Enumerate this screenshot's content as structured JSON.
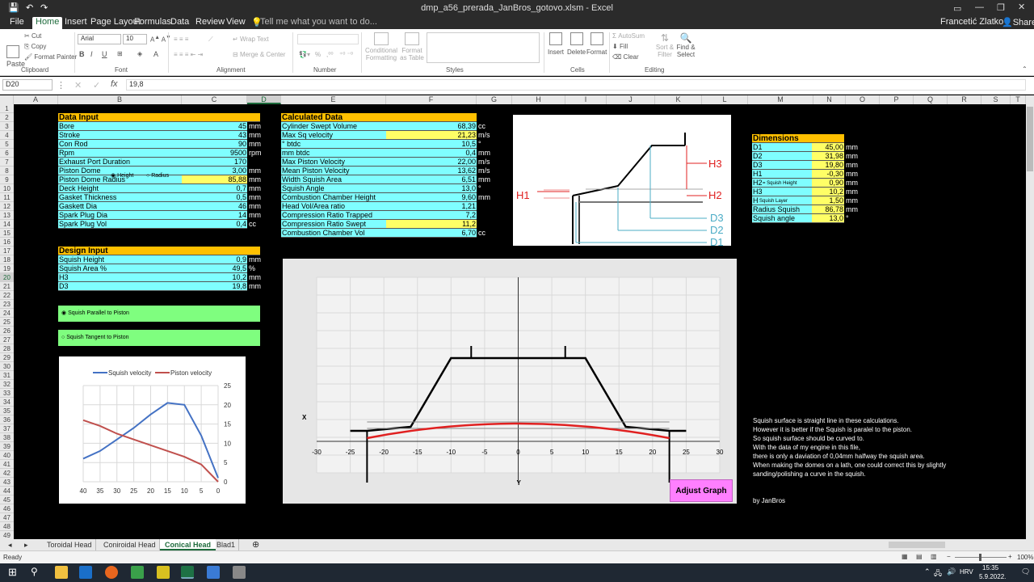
{
  "window": {
    "title": "dmp_a56_prerada_JanBros_gotovo.xlsm - Excel",
    "user": "Francetić Zlatko",
    "share": "Share"
  },
  "tabs": [
    "File",
    "Home",
    "Insert",
    "Page Layout",
    "Formulas",
    "Data",
    "Review",
    "View"
  ],
  "tell_me": "Tell me what you want to do...",
  "ribbon": {
    "clipboard": {
      "paste": "Paste",
      "cut": "Cut",
      "copy": "Copy",
      "format_painter": "Format Painter",
      "label": "Clipboard"
    },
    "font": {
      "name": "Arial",
      "size": "10",
      "label": "Font"
    },
    "alignment": {
      "wrap": "Wrap Text",
      "merge": "Merge & Center",
      "label": "Alignment"
    },
    "number": {
      "label": "Number",
      "percent": "%"
    },
    "styles": {
      "cond": "Conditional Formatting",
      "table": "Format as Table",
      "label": "Styles"
    },
    "cells": {
      "insert": "Insert",
      "delete": "Delete",
      "format": "Format",
      "label": "Cells"
    },
    "editing": {
      "autosum": "AutoSum",
      "fill": "Fill",
      "clear": "Clear",
      "sort": "Sort & Filter",
      "find": "Find & Select",
      "label": "Editing"
    }
  },
  "formula_bar": {
    "name_box": "D20",
    "value": "19,8"
  },
  "columns": [
    "A",
    "B",
    "C",
    "D",
    "E",
    "F",
    "G",
    "H",
    "I",
    "J",
    "K",
    "L",
    "M",
    "N",
    "O",
    "P",
    "Q",
    "R",
    "S",
    "T"
  ],
  "data_input": {
    "title": "Data Input",
    "rows": [
      {
        "label": "Bore",
        "value": "45",
        "unit": "mm"
      },
      {
        "label": "Stroke",
        "value": "43",
        "unit": "mm"
      },
      {
        "label": "Con Rod",
        "value": "90",
        "unit": "mm"
      },
      {
        "label": "Rpm",
        "value": "9500",
        "unit": "rpm"
      },
      {
        "label": "Exhaust Port Duration",
        "value": "170",
        "unit": ""
      },
      {
        "label": "Piston Dome",
        "value": "3,00",
        "unit": "mm"
      },
      {
        "label": "Piston Dome Radius",
        "value": "85,88",
        "unit": "mm"
      },
      {
        "label": "Deck Height",
        "value": "0,7",
        "unit": "mm"
      },
      {
        "label": "Gasket Thickness",
        "value": "0,5",
        "unit": "mm"
      },
      {
        "label": "Gaskett Dia",
        "value": "46",
        "unit": "mm"
      },
      {
        "label": "Spark Plug Dia",
        "value": "14",
        "unit": "mm"
      },
      {
        "label": "Spark Plug Vol",
        "value": "0,4",
        "unit": "cc"
      }
    ],
    "radio_height": "Height",
    "radio_radius": "Radius"
  },
  "design_input": {
    "title": "Design Input",
    "rows": [
      {
        "label": "Squish Height",
        "value": "0,9",
        "unit": "mm"
      },
      {
        "label": "Squish Area   %",
        "value": "49,5",
        "unit": "%"
      },
      {
        "label": "H3",
        "value": "10,2",
        "unit": "mm"
      },
      {
        "label": "D3",
        "value": "19,8",
        "unit": "mm"
      }
    ]
  },
  "options": {
    "parallel": "Squish Parallel to Piston",
    "tangent": "Squish Tangent to Piston"
  },
  "calculated": {
    "title": "Calculated Data",
    "rows": [
      {
        "label": "Cylinder Swept Volume",
        "value": "68,39",
        "unit": "cc"
      },
      {
        "label": "Max Sq velocity",
        "value": "21,23",
        "unit": "m/s"
      },
      {
        "label": "° btdc",
        "value": "10,5",
        "unit": "°"
      },
      {
        "label": "mm btdc",
        "value": "0,4",
        "unit": "mm"
      },
      {
        "label": "Max Piston Velocity",
        "value": "22,00",
        "unit": "m/s"
      },
      {
        "label": "Mean Piston Velocity",
        "value": "13,62",
        "unit": "m/s"
      },
      {
        "label": "Width Squish Area",
        "value": "6,51",
        "unit": "mm"
      },
      {
        "label": "Squish Angle",
        "value": "13,0",
        "unit": "°"
      },
      {
        "label": "Combustion Chamber Height",
        "value": "9,60",
        "unit": "mm"
      },
      {
        "label": "Head Vol/Area ratio",
        "value": "1,21",
        "unit": ""
      },
      {
        "label": "Compression Ratio Trapped",
        "value": "7,2",
        "unit": ""
      },
      {
        "label": "Compression Ratio Swept",
        "value": "11,2",
        "unit": ""
      },
      {
        "label": "Combustion Chamber Vol",
        "value": "6,70",
        "unit": "cc"
      }
    ]
  },
  "dimensions": {
    "title": "Dimensions",
    "rows": [
      {
        "label": "D1",
        "note": "",
        "value": "45,00",
        "unit": "mm"
      },
      {
        "label": "D2",
        "note": "",
        "value": "31,98",
        "unit": "mm"
      },
      {
        "label": "D3",
        "note": "",
        "value": "19,80",
        "unit": "mm"
      },
      {
        "label": "H1",
        "note": "",
        "value": "-0,30",
        "unit": "mm"
      },
      {
        "label": "H2",
        "note": "= Squish Height",
        "value": "0,90",
        "unit": "mm"
      },
      {
        "label": "H3",
        "note": "",
        "value": "10,2",
        "unit": "mm"
      },
      {
        "label": "H",
        "note": "Squish Layer",
        "value": "1,50",
        "unit": "mm"
      },
      {
        "label": "Radius Squish",
        "note": "",
        "value": "86,78",
        "unit": "mm"
      },
      {
        "label": "Squish angle",
        "note": "",
        "value": "13,0",
        "unit": "°"
      }
    ]
  },
  "diagram_labels": {
    "h1": "H1",
    "h2": "H2",
    "h3": "H3",
    "d1": "D1",
    "d2": "D2",
    "d3": "D3"
  },
  "chart_data": [
    {
      "type": "line",
      "series": [
        {
          "name": "Squish velocity",
          "color": "#4472c4"
        },
        {
          "name": "Piston velocity",
          "color": "#c0504d"
        }
      ],
      "x": [
        40,
        35,
        30,
        25,
        20,
        15,
        10,
        5,
        0
      ],
      "squish": [
        6,
        8,
        11,
        14,
        17.5,
        20.5,
        20,
        12,
        1
      ],
      "piston": [
        16,
        14.5,
        12.5,
        11,
        9.5,
        8,
        6.5,
        4.5,
        0
      ],
      "xticks": [
        "40",
        "35",
        "30",
        "25",
        "20",
        "15",
        "10",
        "5",
        "0"
      ],
      "yticks": [
        "25",
        "20",
        "15",
        "10",
        "5",
        "0"
      ],
      "ylim": [
        0,
        25
      ]
    },
    {
      "type": "line",
      "xticks": [
        "-30",
        "-25",
        "-20",
        "-15",
        "-10",
        "-5",
        "0",
        "5",
        "10",
        "15",
        "20",
        "25",
        "30"
      ],
      "xlabel": "X",
      "ylabel": "Y",
      "xlim": [
        -30,
        30
      ]
    }
  ],
  "adjust_graph": "Adjust Graph",
  "notes": [
    "Squish surface is straight line in these calculations.",
    "However it is better if the Squish is paralel to the piston.",
    "So squish surface should be curved to.",
    "With the data of my engine in this file,",
    "there is only a daviation of 0,04mm halfway the squish area.",
    "When making the domes on a lath, one could correct this by slightly",
    "sanding/polishing a curve in the squish."
  ],
  "credit": "by JanBros",
  "sheet_tabs": [
    "Toroidal Head",
    "Coniroidal Head",
    "Conical Head",
    "Blad1"
  ],
  "status": {
    "ready": "Ready",
    "zoom": "100%"
  },
  "taskbar": {
    "time": "15:35",
    "date": "5.9.2022.",
    "lang": "HRV"
  }
}
